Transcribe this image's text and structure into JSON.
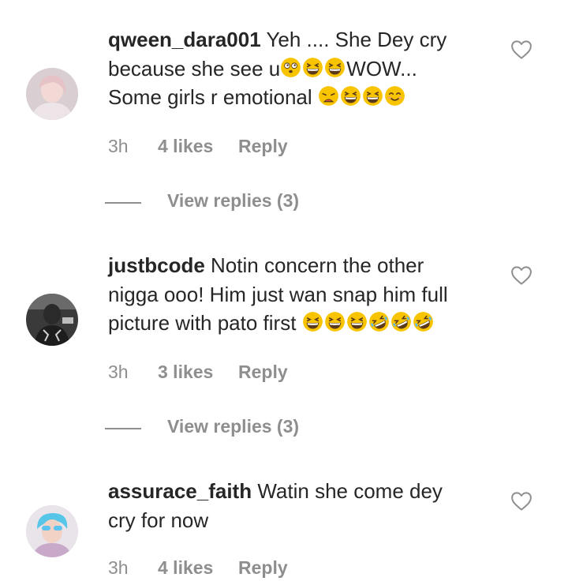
{
  "comments": [
    {
      "username": "qween_dara001",
      "lines": [
        {
          "text": "Yeh .... She Dey cry",
          "emojis": [],
          "after": ""
        },
        {
          "text": "because she see u",
          "emojis": [
            "dizzy-face",
            "grinning-squint",
            "grinning-squint"
          ],
          "after": "WOW..."
        },
        {
          "text": "Some girls r emotional ",
          "emojis": [
            "tired-face",
            "grinning-squint",
            "grinning-squint",
            "smiling-face"
          ],
          "after": ""
        }
      ],
      "time": "3h",
      "likes": "4 likes",
      "reply": "Reply",
      "view_replies": "View replies (3)"
    },
    {
      "username": "justbcode",
      "lines": [
        {
          "text": "Notin concern the other",
          "emojis": [],
          "after": ""
        },
        {
          "text": "nigga ooo! Him just wan snap him full",
          "emojis": [],
          "after": ""
        },
        {
          "text": "picture with pato first ",
          "emojis": [
            "grinning-squint",
            "grinning-squint",
            "grinning-squint",
            "rofl",
            "rofl",
            "rofl"
          ],
          "after": ""
        }
      ],
      "time": "3h",
      "likes": "3 likes",
      "reply": "Reply",
      "view_replies": "View replies (3)"
    },
    {
      "username": "assurace_faith",
      "lines": [
        {
          "text": "Watin she come dey",
          "emojis": [],
          "after": ""
        },
        {
          "text": "cry for now",
          "emojis": [],
          "after": ""
        }
      ],
      "time": "3h",
      "likes": "4 likes",
      "reply": "Reply",
      "view_replies": ""
    }
  ],
  "colors": {
    "text": "#262626",
    "meta": "#8e8e8e",
    "emoji_yellow": "#f8c400",
    "heart_stroke": "#8e8e8e"
  },
  "icons": {
    "heart": "heart-outline-icon",
    "emoji_set": [
      "dizzy-face",
      "grinning-squint",
      "tired-face",
      "smiling-face",
      "rofl"
    ]
  }
}
